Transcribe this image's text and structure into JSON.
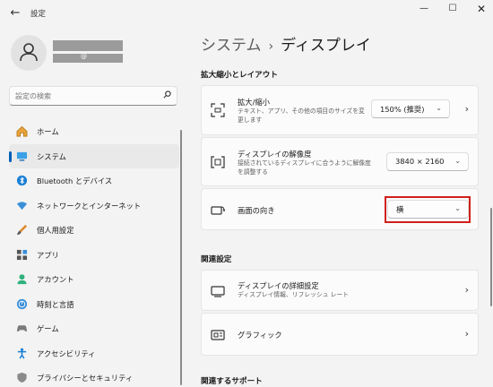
{
  "window": {
    "title": "設定",
    "back_icon": "back-arrow-icon",
    "controls": {
      "minimize": "—",
      "maximize": "☐",
      "close": "✕"
    }
  },
  "user": {
    "email_at": "@"
  },
  "search": {
    "placeholder": "設定の検索",
    "icon": "search-icon"
  },
  "sidebar": {
    "items": [
      {
        "label": "ホーム",
        "icon": "home-icon"
      },
      {
        "label": "システム",
        "icon": "system-icon",
        "active": true
      },
      {
        "label": "Bluetooth とデバイス",
        "icon": "bluetooth-icon"
      },
      {
        "label": "ネットワークとインターネット",
        "icon": "wifi-icon"
      },
      {
        "label": "個人用設定",
        "icon": "brush-icon"
      },
      {
        "label": "アプリ",
        "icon": "apps-icon"
      },
      {
        "label": "アカウント",
        "icon": "account-icon"
      },
      {
        "label": "時刻と言語",
        "icon": "globe-icon"
      },
      {
        "label": "ゲーム",
        "icon": "gamepad-icon"
      },
      {
        "label": "アクセシビリティ",
        "icon": "accessibility-icon"
      },
      {
        "label": "プライバシーとセキュリティ",
        "icon": "shield-icon"
      }
    ]
  },
  "breadcrumb": {
    "parent": "システム",
    "separator": "›",
    "current": "ディスプレイ"
  },
  "scale_layout": {
    "heading": "拡大縮小とレイアウト",
    "scale": {
      "title": "拡大/縮小",
      "desc": "テキスト、アプリ、その他の項目のサイズを変更します",
      "value": "150% (推奨)"
    },
    "resolution": {
      "title": "ディスプレイの解像度",
      "desc": "接続されているディスプレイに合うように解像度を調整する",
      "value": "3840 × 2160"
    },
    "orientation": {
      "title": "画面の向き",
      "value": "横"
    }
  },
  "related": {
    "heading": "関連設定",
    "advanced": {
      "title": "ディスプレイの詳細設定",
      "desc": "ディスプレイ情報、リフレッシュ レート"
    },
    "graphics": {
      "title": "グラフィック"
    }
  },
  "support": {
    "heading": "関連するサポート"
  },
  "colors": {
    "accent": "#005fb8",
    "highlight": "#d0201b"
  }
}
